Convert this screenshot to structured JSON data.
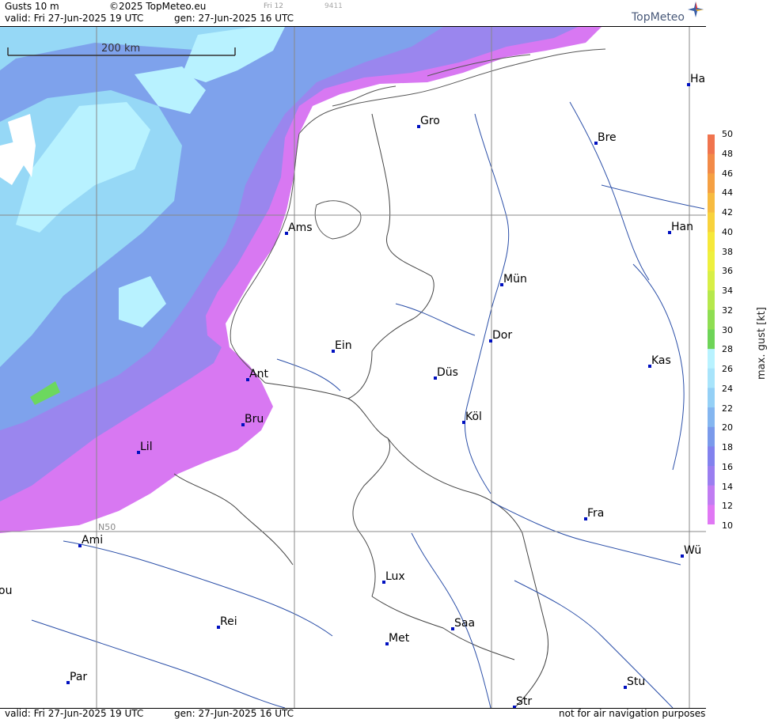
{
  "header": {
    "product": "Gusts 10 m",
    "copyright": "©2025 TopMeteo.eu",
    "run_small": "Fri 12",
    "code_small": "9411",
    "valid": "valid:  Fri  27-Jun-2025  19 UTC",
    "gen": "gen: 27-Jun-2025 16 UTC",
    "logo": "TopMeteo"
  },
  "footer": {
    "valid": "valid:  Fri  27-Jun-2025  19 UTC",
    "gen": "gen: 27-Jun-2025 16 UTC",
    "note": "not for air navigation purposes"
  },
  "map": {
    "scale_label": "200 km",
    "lat_label": "N50",
    "cities": [
      {
        "name": "Gro"
      },
      {
        "name": "Bre"
      },
      {
        "name": "Ha"
      },
      {
        "name": "Ams"
      },
      {
        "name": "Han"
      },
      {
        "name": "Mün"
      },
      {
        "name": "Dor"
      },
      {
        "name": "Ein"
      },
      {
        "name": "Ant"
      },
      {
        "name": "Düs"
      },
      {
        "name": "Kas"
      },
      {
        "name": "Bru"
      },
      {
        "name": "Köl"
      },
      {
        "name": "Lil"
      },
      {
        "name": "Fra"
      },
      {
        "name": "Ami"
      },
      {
        "name": "Wü"
      },
      {
        "name": "Lux"
      },
      {
        "name": "ou"
      },
      {
        "name": "Rei"
      },
      {
        "name": "Saa"
      },
      {
        "name": "Met"
      },
      {
        "name": "Par"
      },
      {
        "name": "Stu"
      },
      {
        "name": "Str"
      }
    ]
  },
  "legend": {
    "unit": "max. gust [kt]",
    "ticks": [
      "50",
      "48",
      "46",
      "44",
      "42",
      "40",
      "38",
      "36",
      "34",
      "32",
      "30",
      "28",
      "26",
      "24",
      "22",
      "20",
      "18",
      "16",
      "14",
      "12",
      "10"
    ],
    "colors": [
      "#f0744e",
      "#f28a48",
      "#f5a043",
      "#f7bb40",
      "#f8d23c",
      "#f6e83a",
      "#eef03e",
      "#d8ef46",
      "#b6e84c",
      "#8fde52",
      "#6ed458",
      "#b8f2ff",
      "#a8e4fb",
      "#94d0f6",
      "#84b6f0",
      "#7a9aeb",
      "#8282ee",
      "#9a7ef0",
      "#c07cf2",
      "#e078f4"
    ]
  },
  "colors": {
    "water_light": "#b8f2ff",
    "water_mid": "#96d8f6",
    "blue": "#7ea2ec",
    "violet": "#9086ee",
    "magenta": "#d878f2",
    "green": "#6cd85e"
  }
}
